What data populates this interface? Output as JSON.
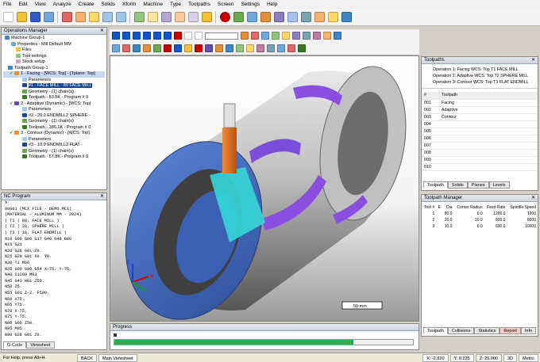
{
  "menu": [
    "File",
    "Edit",
    "View",
    "Analyze",
    "Create",
    "Solids",
    "Xform",
    "Machine",
    "Type",
    "Toolpaths",
    "Screen",
    "Settings",
    "Help"
  ],
  "ops": {
    "title": "Operations Manager",
    "items": [
      "Machine Group-1",
      "Properties - Mill Default MM",
      "Files",
      "Tool settings",
      "Stock setup",
      "Toolpath Group-1",
      "1 - Facing - [WCS: Top] - [Tplane: Top]",
      "Parameters",
      "#1 - FACE MILL - 80 FACE MILL",
      "Geometry - (1) chain(s)",
      "Toolpath - 53.5K - Program # 0",
      "2 - Adaptive (Dynamic) - [WCS: Top]",
      "Parameters",
      "#2 - 20.0 ENDMILL2 SPHERE -",
      "Geometry - (1) chain(s)",
      "Toolpath - 286.1K - Program # 0",
      "3 - Contour (Dynamic) - [WCS: Top]",
      "Parameters",
      "#3 - 10.0 ENDMILL2 FLAT -",
      "Geometry - (1) chain(s)",
      "Toolpath - 57.8K - Program # 0"
    ]
  },
  "nc": {
    "title": "NC Program",
    "lines": [
      "%",
      "00001 (MCX FILE - DEMO.MCX)",
      "(MATERIAL - ALUMINUM MM - 2024)",
      "( T1 | 80. FACE MILL )",
      "( T2 | 20. SPHERE MILL )",
      "( T3 | 10. FLAT ENDMILL )",
      "N10 G90 G00 G17 G40 G49 G80",
      "N15 G21",
      "N20 G28 G91 Z0.",
      "N25 G28 G91 X0. Y0.",
      "N30 T1 M06",
      "N35 G00 G90 G54 X-75. Y-75.",
      "N40 S1200 M03",
      "N45 G43 H01 Z50.",
      "N50 Z5.",
      "N55 G01 Z-2. F500.",
      "N60 X75.",
      "N65 Y75.",
      "N70 X-75.",
      "N75 Y-75.",
      "N80 G00 Z50.",
      "N85 M05",
      "N90 G28 G91 Z0.",
      "N95 M30",
      "%"
    ],
    "tabs": [
      "G-Code",
      "Viewsheet"
    ]
  },
  "toolpaths": {
    "title": "Toolpaths",
    "summary": [
      "Operation 1: Facing   WCS: Top T1 FACE MILL",
      "Operation 2: Adaptive  WCS: Top T2 SPHERE MILL",
      "Operation 3: Contour   WCS: Top T3 FLAT ENDMILL"
    ],
    "col_num": "#",
    "col_name": "Toolpath",
    "rows": [
      [
        "001",
        "Facing"
      ],
      [
        "002",
        "Adaptive"
      ],
      [
        "003",
        "Contour"
      ],
      [
        "004",
        ""
      ],
      [
        "005",
        ""
      ],
      [
        "006",
        ""
      ],
      [
        "007",
        ""
      ],
      [
        "008",
        ""
      ],
      [
        "009",
        ""
      ],
      [
        "010",
        ""
      ]
    ],
    "tabs": [
      "Toolpath",
      "Solids",
      "Planes",
      "Levels"
    ]
  },
  "toolmgr": {
    "title": "Toolpath Manager",
    "headers": [
      "Tool #",
      "E",
      "Dia",
      "Corner Radius",
      "Feed Rate",
      "Spindle Speed"
    ],
    "rows": [
      [
        "1",
        "",
        "80.0",
        "0.0",
        "1200.0",
        "1200"
      ],
      [
        "2",
        "",
        "20.0",
        "10.0",
        "800.0",
        "8000"
      ],
      [
        "3",
        "",
        "10.0",
        "0.0",
        "600.0",
        "10000"
      ]
    ],
    "tabs": [
      "Toolpath",
      "Collisions",
      "Statistics",
      "Report",
      "Info"
    ]
  },
  "progress": {
    "title": "Progress",
    "value": 0.8
  },
  "viewport": {
    "scale_label": "50 mm",
    "axis_x": "X",
    "axis_y": "Y",
    "axis_z": "Z"
  },
  "status": {
    "help": "For Help, press Alt+H.",
    "back": "BACK",
    "view": "Main Viewsheet",
    "x": "X:  -2.820",
    "y": "Y:  8.235",
    "z": "Z:  25.000",
    "mode": "3D",
    "units": "Metric"
  },
  "colors": {
    "part_blue": "#4a72c4",
    "part_gray": "#a8a8a8",
    "tool_orange": "#e5761e",
    "path_cyan": "#35d7d7",
    "path_purple": "#8a4ee0",
    "progress": "#22b14c"
  }
}
